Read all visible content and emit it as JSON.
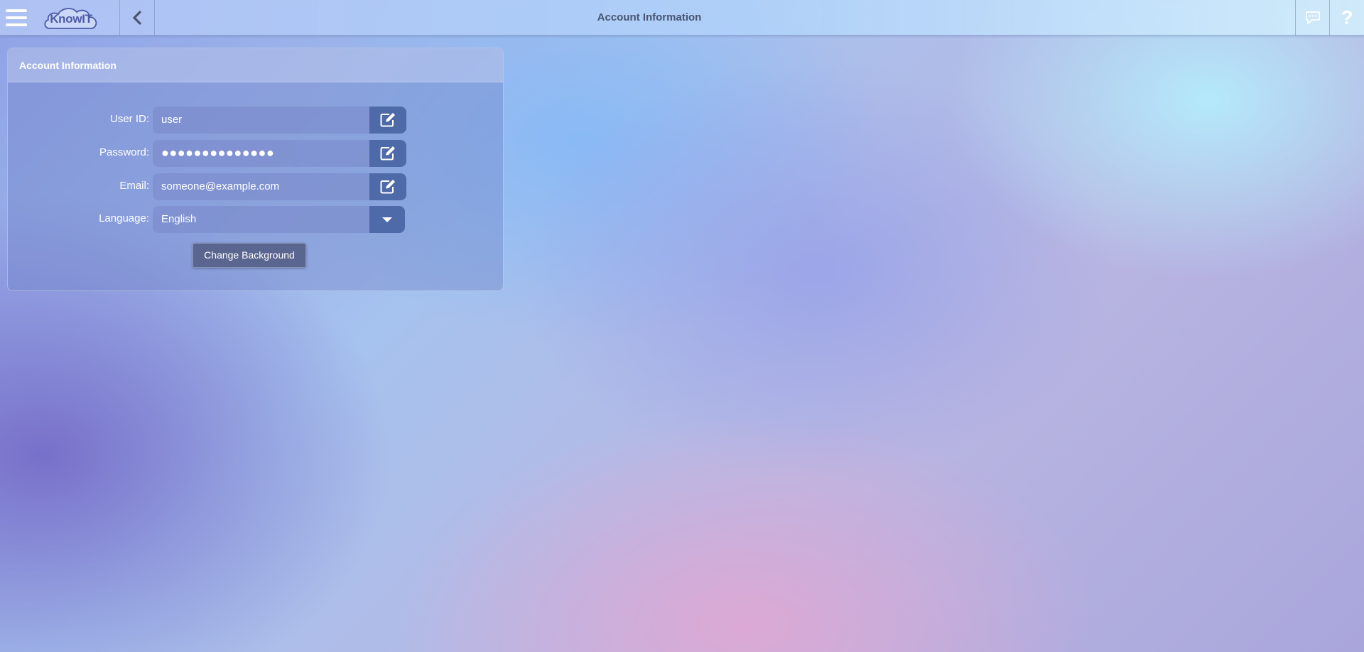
{
  "app": {
    "logo_text": "KnowIT",
    "page_title": "Account Information"
  },
  "topbar": {
    "icons": {
      "menu": "hamburger-icon",
      "back": "chevron-left-icon",
      "chat": "chat-bubble-icon",
      "help": "question-mark-icon"
    },
    "help_glyph": "?"
  },
  "panel": {
    "title": "Account Information",
    "fields": {
      "user_id": {
        "label": "User ID:",
        "value": "user"
      },
      "password": {
        "label": "Password:",
        "value": "●●●●●●●●●●●●●●"
      },
      "email": {
        "label": "Email:",
        "value": "someone@example.com"
      },
      "language": {
        "label": "Language:",
        "value": "English"
      }
    },
    "change_background_label": "Change Background"
  },
  "colors": {
    "button_blue": "#4e6aa8",
    "title_text": "#4a5472",
    "logo_text": "#4d5aa8"
  }
}
